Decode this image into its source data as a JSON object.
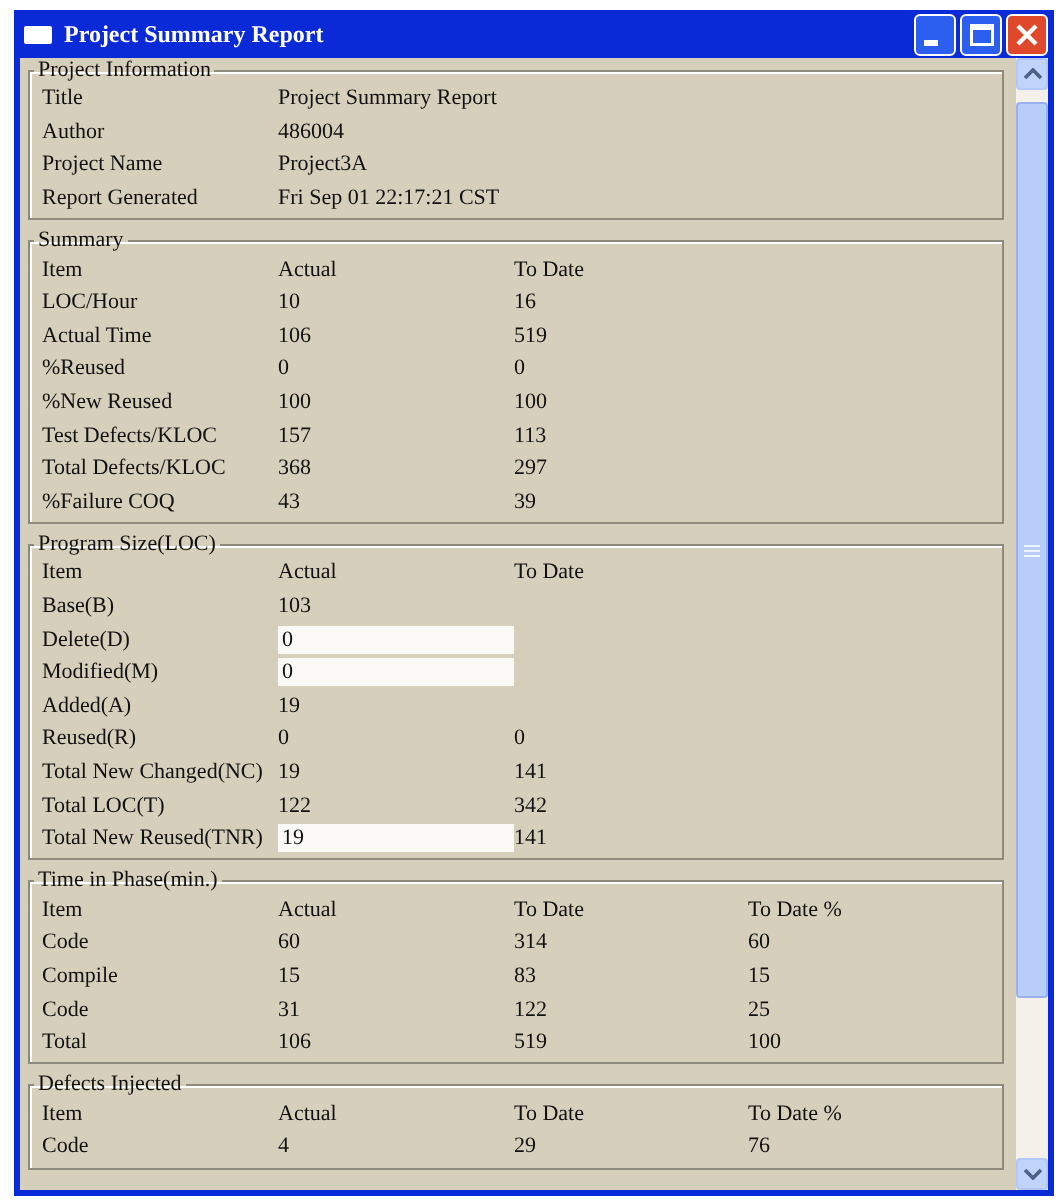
{
  "window": {
    "title": "Project Summary Report"
  },
  "sections": [
    {
      "title": "Project Information",
      "rows": [
        {
          "cells": [
            "Title",
            "Project Summary Report"
          ]
        },
        {
          "cells": [
            "Author",
            "486004"
          ]
        },
        {
          "cells": [
            "Project Name",
            "Project3A"
          ]
        },
        {
          "cells": [
            "Report Generated",
            "Fri Sep 01 22:17:21 CST"
          ]
        }
      ]
    },
    {
      "title": "Summary",
      "header": [
        "Item",
        "Actual",
        "To Date"
      ],
      "rows": [
        {
          "cells": [
            "LOC/Hour",
            "10",
            "16"
          ]
        },
        {
          "cells": [
            "Actual Time",
            "106",
            "519"
          ]
        },
        {
          "cells": [
            "%Reused",
            "0",
            "0"
          ]
        },
        {
          "cells": [
            "%New Reused",
            "100",
            "100"
          ]
        },
        {
          "cells": [
            "Test Defects/KLOC",
            "157",
            "113"
          ]
        },
        {
          "cells": [
            "Total Defects/KLOC",
            "368",
            "297"
          ]
        },
        {
          "cells": [
            "%Failure COQ",
            "43",
            "39"
          ]
        }
      ]
    },
    {
      "title": "Program Size(LOC)",
      "header": [
        "Item",
        "Actual",
        "To Date"
      ],
      "rows": [
        {
          "kind": "text",
          "cells": [
            "Base(B)",
            "103"
          ]
        },
        {
          "kind": "field",
          "cells": [
            "Delete(D)",
            "0"
          ]
        },
        {
          "kind": "field",
          "cells": [
            "Modified(M)",
            "0"
          ]
        },
        {
          "kind": "text",
          "cells": [
            "Added(A)",
            "19"
          ]
        },
        {
          "kind": "text",
          "cells": [
            "Reused(R)",
            "0",
            "0"
          ]
        },
        {
          "kind": "text",
          "cells": [
            "Total New Changed(NC)",
            "19",
            "141"
          ]
        },
        {
          "kind": "text",
          "cells": [
            "Total LOC(T)",
            "122",
            "342"
          ]
        },
        {
          "kind": "field",
          "cells": [
            "Total New Reused(TNR)",
            "19",
            "141"
          ]
        }
      ]
    },
    {
      "title": "Time in Phase(min.)",
      "header": [
        "Item",
        "Actual",
        "To Date",
        "To Date %"
      ],
      "rows": [
        {
          "cells": [
            "Code",
            "60",
            "314",
            "60"
          ]
        },
        {
          "cells": [
            "Compile",
            "15",
            "83",
            "15"
          ]
        },
        {
          "cells": [
            "Code",
            "31",
            "122",
            "25"
          ]
        },
        {
          "cells": [
            "Total",
            "106",
            "519",
            "100"
          ]
        }
      ]
    },
    {
      "title": "Defects Injected",
      "header": [
        "Item",
        "Actual",
        "To Date",
        "To Date %"
      ],
      "rows": [
        {
          "cells": [
            "Code",
            "4",
            "29",
            "76"
          ]
        }
      ]
    }
  ]
}
